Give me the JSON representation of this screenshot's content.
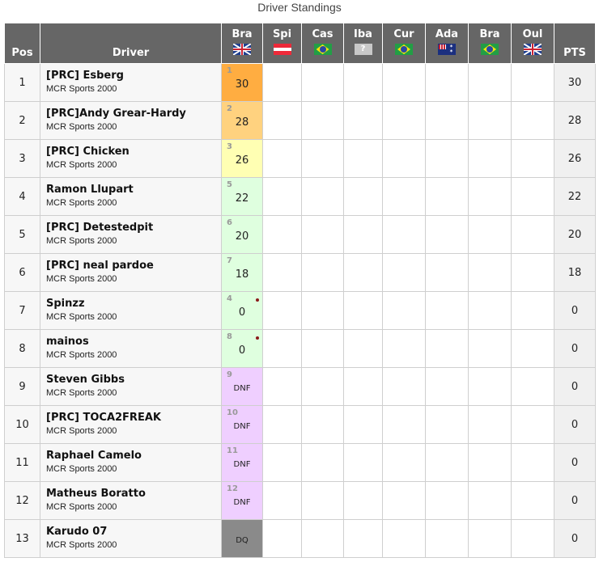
{
  "title": "Driver Standings",
  "headers": {
    "pos": "Pos",
    "driver": "Driver",
    "pts": "PTS"
  },
  "races": [
    {
      "name": "Bra",
      "flag": "uk-flag-icon"
    },
    {
      "name": "Spi",
      "flag": "austria-flag-icon"
    },
    {
      "name": "Cas",
      "flag": "brazil-flag-icon"
    },
    {
      "name": "Iba",
      "flag": "unknown-flag-icon",
      "flag_text": "?"
    },
    {
      "name": "Cur",
      "flag": "brazil-flag-icon"
    },
    {
      "name": "Ada",
      "flag": "australia-flag-icon"
    },
    {
      "name": "Bra",
      "flag": "brazil-flag-icon"
    },
    {
      "name": "Oul",
      "flag": "uk-flag-icon"
    }
  ],
  "colors": {
    "header_bg": "#666666",
    "p1": "#ffad41",
    "p2": "#ffd27f",
    "p3": "#ffffb3",
    "points": "#dfffdf",
    "dnf": "#efcfff",
    "dq": "#8a8a8a",
    "penalty_dot": "#8b1a1a"
  },
  "rows": [
    {
      "pos": "1",
      "driver": "[PRC] Esberg",
      "team": "MCR Sports 2000",
      "quali": "1",
      "result": "30",
      "result_class": "p1",
      "penalty": false,
      "pts": "30"
    },
    {
      "pos": "2",
      "driver": "[PRC]Andy Grear-Hardy",
      "team": "MCR Sports 2000",
      "quali": "2",
      "result": "28",
      "result_class": "p2",
      "penalty": false,
      "pts": "28"
    },
    {
      "pos": "3",
      "driver": "[PRC] Chicken",
      "team": "MCR Sports 2000",
      "quali": "3",
      "result": "26",
      "result_class": "p3",
      "penalty": false,
      "pts": "26"
    },
    {
      "pos": "4",
      "driver": "Ramon Llupart",
      "team": "MCR Sports 2000",
      "quali": "5",
      "result": "22",
      "result_class": "points",
      "penalty": false,
      "pts": "22"
    },
    {
      "pos": "5",
      "driver": "[PRC] Detestedpit",
      "team": "MCR Sports 2000",
      "quali": "6",
      "result": "20",
      "result_class": "points",
      "penalty": false,
      "pts": "20"
    },
    {
      "pos": "6",
      "driver": "[PRC] neal pardoe",
      "team": "MCR Sports 2000",
      "quali": "7",
      "result": "18",
      "result_class": "points",
      "penalty": false,
      "pts": "18"
    },
    {
      "pos": "7",
      "driver": "Spinzz",
      "team": "MCR Sports 2000",
      "quali": "4",
      "result": "0",
      "result_class": "points",
      "penalty": true,
      "pts": "0"
    },
    {
      "pos": "8",
      "driver": "mainos",
      "team": "MCR Sports 2000",
      "quali": "8",
      "result": "0",
      "result_class": "points",
      "penalty": true,
      "pts": "0"
    },
    {
      "pos": "9",
      "driver": "Steven Gibbs",
      "team": "MCR Sports 2000",
      "quali": "9",
      "result": "DNF",
      "result_class": "dnf",
      "penalty": false,
      "pts": "0"
    },
    {
      "pos": "10",
      "driver": "[PRC] TOCA2FREAK",
      "team": "MCR Sports 2000",
      "quali": "10",
      "result": "DNF",
      "result_class": "dnf",
      "penalty": false,
      "pts": "0"
    },
    {
      "pos": "11",
      "driver": "Raphael Camelo",
      "team": "MCR Sports 2000",
      "quali": "11",
      "result": "DNF",
      "result_class": "dnf",
      "penalty": false,
      "pts": "0"
    },
    {
      "pos": "12",
      "driver": "Matheus Boratto",
      "team": "MCR Sports 2000",
      "quali": "12",
      "result": "DNF",
      "result_class": "dnf",
      "penalty": false,
      "pts": "0"
    },
    {
      "pos": "13",
      "driver": "Karudo 07",
      "team": "MCR Sports 2000",
      "quali": "",
      "result": "DQ",
      "result_class": "dq",
      "penalty": false,
      "pts": "0"
    }
  ]
}
